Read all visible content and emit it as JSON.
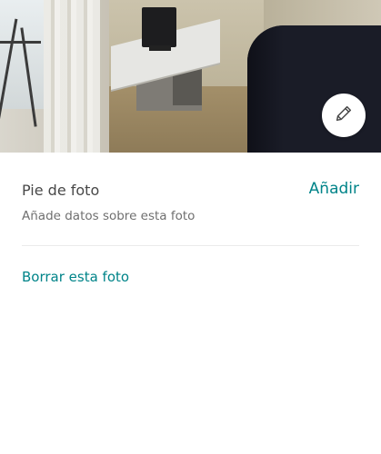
{
  "photo": {
    "description_icon": "pencil-icon"
  },
  "caption": {
    "title": "Pie de foto",
    "add_label": "Añadir",
    "subtitle": "Añade datos sobre esta foto"
  },
  "actions": {
    "delete_label": "Borrar esta foto"
  },
  "colors": {
    "accent": "#008489",
    "text_primary": "#484848",
    "text_secondary": "#6f6f6f"
  }
}
